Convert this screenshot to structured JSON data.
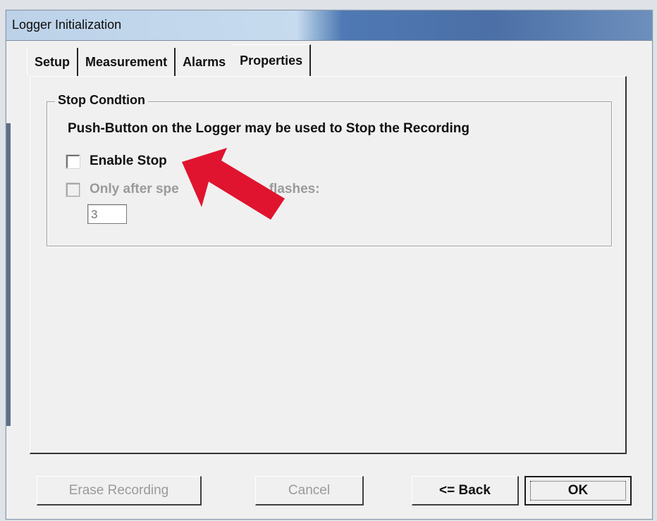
{
  "window": {
    "title": "Logger Initialization"
  },
  "tabs": [
    {
      "label": "Setup"
    },
    {
      "label": "Measurement"
    },
    {
      "label": "Alarms"
    },
    {
      "label": "Properties",
      "active": true
    }
  ],
  "stop_condition": {
    "group_title": "Stop Condtion",
    "info_text": "Push-Button on the Logger may be used to Stop the Recording",
    "enable_stop": {
      "label": "Enable Stop",
      "checked": false
    },
    "only_after": {
      "label_start": "Only after spe",
      "label_end": "flashes:",
      "checked": false,
      "disabled": true
    },
    "flashes_value": "3"
  },
  "buttons": {
    "erase": "Erase Recording",
    "cancel": "Cancel",
    "back": "<= Back",
    "ok": "OK"
  },
  "colors": {
    "annotation_arrow": "#e0142e",
    "title_bar_dark": "#4b6fa6"
  }
}
